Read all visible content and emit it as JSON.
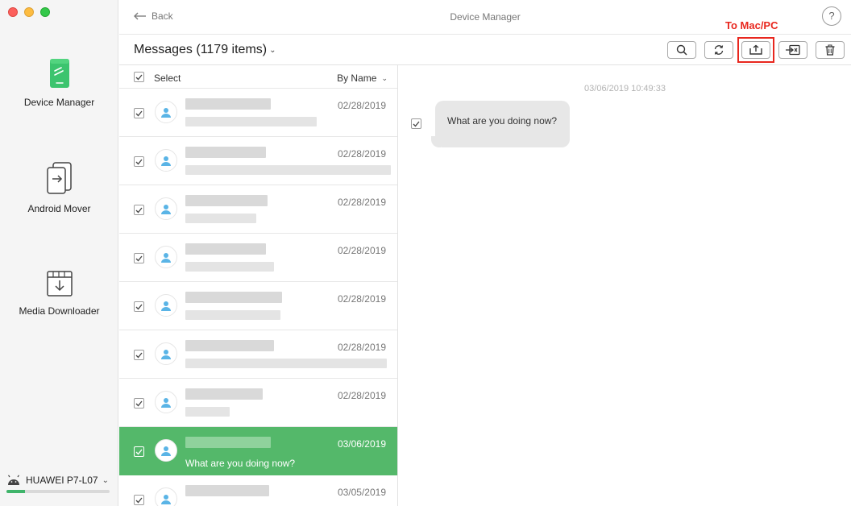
{
  "window": {
    "title": "Device Manager",
    "back_label": "Back",
    "help_label": "?"
  },
  "sidebar": {
    "items": [
      {
        "label": "Device Manager",
        "icon": "device-manager-icon",
        "active": true
      },
      {
        "label": "Android Mover",
        "icon": "android-mover-icon",
        "active": false
      },
      {
        "label": "Media Downloader",
        "icon": "media-downloader-icon",
        "active": false
      }
    ],
    "device": {
      "name": "HUAWEI P7-L07",
      "storage_used_fraction": 0.18
    }
  },
  "toolbar": {
    "title": "Messages (1179 items)",
    "annotation": "To Mac/PC",
    "buttons": [
      "search-icon",
      "refresh-icon",
      "export-to-computer-icon",
      "export-to-device-icon",
      "trash-icon"
    ]
  },
  "list": {
    "select_label": "Select",
    "sort_label": "By Name",
    "rows": [
      {
        "date": "02/28/2019",
        "preview": "",
        "selected": false
      },
      {
        "date": "02/28/2019",
        "preview": "",
        "selected": false
      },
      {
        "date": "02/28/2019",
        "preview": "",
        "selected": false
      },
      {
        "date": "02/28/2019",
        "preview": "",
        "selected": false
      },
      {
        "date": "02/28/2019",
        "preview": "",
        "selected": false
      },
      {
        "date": "02/28/2019",
        "preview": "",
        "selected": false
      },
      {
        "date": "02/28/2019",
        "preview": "",
        "selected": false
      },
      {
        "date": "03/06/2019",
        "preview": "What are you doing now?",
        "selected": true
      },
      {
        "date": "03/05/2019",
        "preview": "",
        "selected": false
      }
    ]
  },
  "detail": {
    "timestamp": "03/06/2019 10:49:33",
    "message": "What are you doing now?"
  },
  "colors": {
    "accent": "#54b86a",
    "annotation": "#e8271e",
    "avatar": "#5ab4e6"
  }
}
